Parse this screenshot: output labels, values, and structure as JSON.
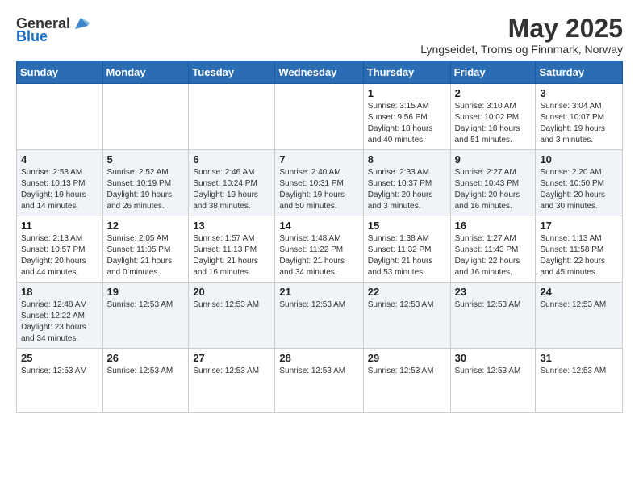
{
  "header": {
    "logo_general": "General",
    "logo_blue": "Blue",
    "title": "May 2025",
    "subtitle": "Lyngseidet, Troms og Finnmark, Norway"
  },
  "days_of_week": [
    "Sunday",
    "Monday",
    "Tuesday",
    "Wednesday",
    "Thursday",
    "Friday",
    "Saturday"
  ],
  "weeks": [
    [
      {
        "day": "",
        "info": ""
      },
      {
        "day": "",
        "info": ""
      },
      {
        "day": "",
        "info": ""
      },
      {
        "day": "",
        "info": ""
      },
      {
        "day": "1",
        "info": "Sunrise: 3:15 AM\nSunset: 9:56 PM\nDaylight: 18 hours\nand 40 minutes."
      },
      {
        "day": "2",
        "info": "Sunrise: 3:10 AM\nSunset: 10:02 PM\nDaylight: 18 hours\nand 51 minutes."
      },
      {
        "day": "3",
        "info": "Sunrise: 3:04 AM\nSunset: 10:07 PM\nDaylight: 19 hours\nand 3 minutes."
      }
    ],
    [
      {
        "day": "4",
        "info": "Sunrise: 2:58 AM\nSunset: 10:13 PM\nDaylight: 19 hours\nand 14 minutes."
      },
      {
        "day": "5",
        "info": "Sunrise: 2:52 AM\nSunset: 10:19 PM\nDaylight: 19 hours\nand 26 minutes."
      },
      {
        "day": "6",
        "info": "Sunrise: 2:46 AM\nSunset: 10:24 PM\nDaylight: 19 hours\nand 38 minutes."
      },
      {
        "day": "7",
        "info": "Sunrise: 2:40 AM\nSunset: 10:31 PM\nDaylight: 19 hours\nand 50 minutes."
      },
      {
        "day": "8",
        "info": "Sunrise: 2:33 AM\nSunset: 10:37 PM\nDaylight: 20 hours\nand 3 minutes."
      },
      {
        "day": "9",
        "info": "Sunrise: 2:27 AM\nSunset: 10:43 PM\nDaylight: 20 hours\nand 16 minutes."
      },
      {
        "day": "10",
        "info": "Sunrise: 2:20 AM\nSunset: 10:50 PM\nDaylight: 20 hours\nand 30 minutes."
      }
    ],
    [
      {
        "day": "11",
        "info": "Sunrise: 2:13 AM\nSunset: 10:57 PM\nDaylight: 20 hours\nand 44 minutes."
      },
      {
        "day": "12",
        "info": "Sunrise: 2:05 AM\nSunset: 11:05 PM\nDaylight: 21 hours\nand 0 minutes."
      },
      {
        "day": "13",
        "info": "Sunrise: 1:57 AM\nSunset: 11:13 PM\nDaylight: 21 hours\nand 16 minutes."
      },
      {
        "day": "14",
        "info": "Sunrise: 1:48 AM\nSunset: 11:22 PM\nDaylight: 21 hours\nand 34 minutes."
      },
      {
        "day": "15",
        "info": "Sunrise: 1:38 AM\nSunset: 11:32 PM\nDaylight: 21 hours\nand 53 minutes."
      },
      {
        "day": "16",
        "info": "Sunrise: 1:27 AM\nSunset: 11:43 PM\nDaylight: 22 hours\nand 16 minutes."
      },
      {
        "day": "17",
        "info": "Sunrise: 1:13 AM\nSunset: 11:58 PM\nDaylight: 22 hours\nand 45 minutes."
      }
    ],
    [
      {
        "day": "18",
        "info": "Sunrise: 12:48 AM\nSunset: 12:22 AM\nDaylight: 23 hours\nand 34 minutes."
      },
      {
        "day": "19",
        "info": "Sunrise: 12:53 AM"
      },
      {
        "day": "20",
        "info": "Sunrise: 12:53 AM"
      },
      {
        "day": "21",
        "info": "Sunrise: 12:53 AM"
      },
      {
        "day": "22",
        "info": "Sunrise: 12:53 AM"
      },
      {
        "day": "23",
        "info": "Sunrise: 12:53 AM"
      },
      {
        "day": "24",
        "info": "Sunrise: 12:53 AM"
      }
    ],
    [
      {
        "day": "25",
        "info": "Sunrise: 12:53 AM"
      },
      {
        "day": "26",
        "info": "Sunrise: 12:53 AM"
      },
      {
        "day": "27",
        "info": "Sunrise: 12:53 AM"
      },
      {
        "day": "28",
        "info": "Sunrise: 12:53 AM"
      },
      {
        "day": "29",
        "info": "Sunrise: 12:53 AM"
      },
      {
        "day": "30",
        "info": "Sunrise: 12:53 AM"
      },
      {
        "day": "31",
        "info": "Sunrise: 12:53 AM"
      }
    ]
  ]
}
